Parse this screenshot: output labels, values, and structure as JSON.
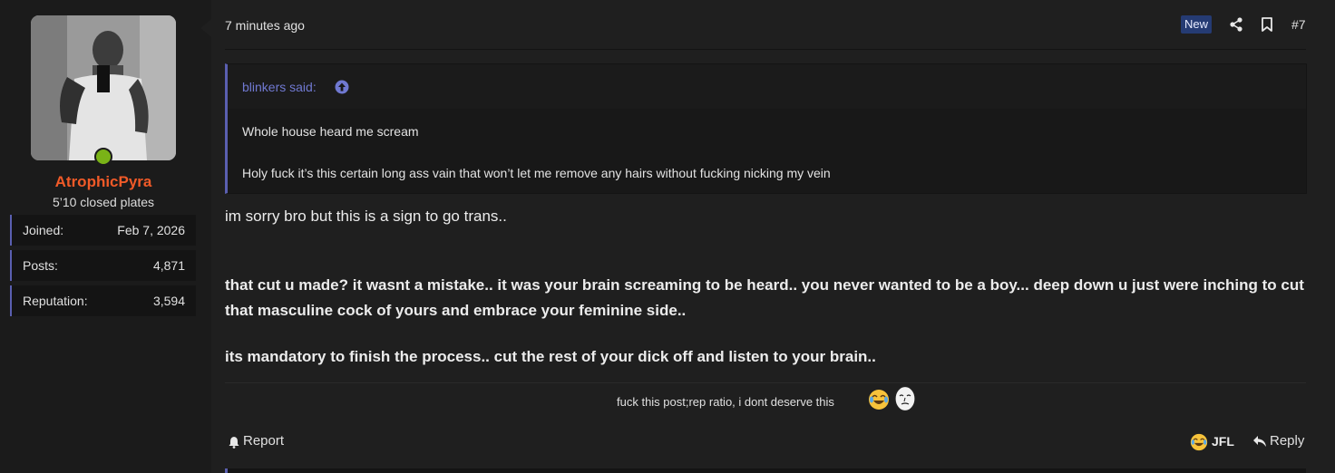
{
  "user": {
    "name": "AtrophicPyra",
    "title": "5’10 closed plates",
    "online": true,
    "stats": [
      {
        "label": "Joined:",
        "value": "Feb 7, 2026"
      },
      {
        "label": "Posts:",
        "value": "4,871"
      },
      {
        "label": "Reputation:",
        "value": "3,594"
      }
    ]
  },
  "post": {
    "time": "7 minutes ago",
    "badge": "New",
    "number": "#7",
    "quote": {
      "author": "blinkers said:",
      "lines": [
        "Whole house heard me scream",
        "Holy fuck it’s this certain long ass vain that won’t let me remove any hairs without fucking nicking my vein"
      ]
    },
    "body": {
      "p1": "im sorry bro but this is a sign to go trans..",
      "p2": "that cut u made? it wasnt a mistake.. it was your brain screaming to be heard.. you never wanted to be a boy... deep down u just were inching to cut that masculine cock of yours and embrace your feminine side..",
      "p3": "its mandatory to finish the process.. cut the rest of your dick off and listen to your brain.."
    },
    "signature": "fuck this post;rep ratio, i dont deserve this"
  },
  "actions": {
    "report": "Report",
    "reaction": "JFL",
    "reply": "Reply"
  },
  "colors": {
    "username": "#f05a28",
    "accent": "#5a5fb0",
    "quote_author": "#7079d1",
    "badge_bg": "#253b73",
    "online": "#7ab317"
  },
  "icons": [
    "share-icon",
    "bookmark-icon",
    "arrow-up-circle-icon",
    "bell-icon",
    "joy-emoji-icon",
    "reply-arrow-icon"
  ]
}
